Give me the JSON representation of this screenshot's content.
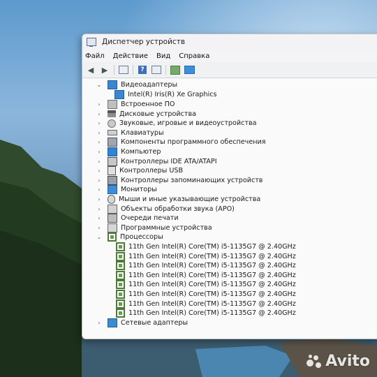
{
  "window": {
    "title": "Диспетчер устройств"
  },
  "menu": [
    "Файл",
    "Действие",
    "Вид",
    "Справка"
  ],
  "toolbar_icons": [
    "back-arrow-icon",
    "forward-arrow-icon",
    "properties-icon",
    "help-icon",
    "view-icon",
    "update-driver-icon",
    "monitor-icon"
  ],
  "tree": {
    "video": {
      "label": "Видеоадаптеры",
      "children": [
        "Intel(R) Iris(R) Xe Graphics"
      ]
    },
    "categories": [
      "Встроенное ПО",
      "Дисковые устройства",
      "Звуковые, игровые и видеоустройства",
      "Клавиатуры",
      "Компоненты программного обеспечения",
      "Компьютер",
      "Контроллеры IDE ATA/ATAPI",
      "Контроллеры USB",
      "Контроллеры запоминающих устройств",
      "Мониторы",
      "Мыши и иные указывающие устройства",
      "Объекты обработки звука (APO)",
      "Очереди печати",
      "Программные устройства"
    ],
    "processors": {
      "label": "Процессоры",
      "children": [
        "11th Gen Intel(R) Core(TM) i5-1135G7 @ 2.40GHz",
        "11th Gen Intel(R) Core(TM) i5-1135G7 @ 2.40GHz",
        "11th Gen Intel(R) Core(TM) i5-1135G7 @ 2.40GHz",
        "11th Gen Intel(R) Core(TM) i5-1135G7 @ 2.40GHz",
        "11th Gen Intel(R) Core(TM) i5-1135G7 @ 2.40GHz",
        "11th Gen Intel(R) Core(TM) i5-1135G7 @ 2.40GHz",
        "11th Gen Intel(R) Core(TM) i5-1135G7 @ 2.40GHz",
        "11th Gen Intel(R) Core(TM) i5-1135G7 @ 2.40GHz"
      ]
    },
    "network": {
      "label": "Сетевые адаптеры"
    }
  },
  "watermark": "Avito"
}
